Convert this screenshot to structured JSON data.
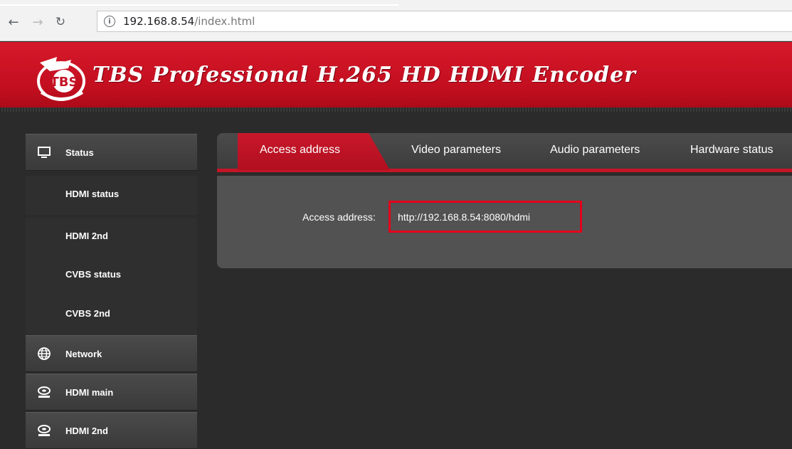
{
  "browser": {
    "back_icon": "back-arrow-icon",
    "forward_icon": "forward-arrow-icon",
    "reload_icon": "reload-icon",
    "url_host": "192.168.8.54",
    "url_path": "/index.html"
  },
  "banner": {
    "title": "TBS Professional H.265 HD HDMI Encoder",
    "logo_text": "TBS"
  },
  "sidebar": {
    "sections": [
      {
        "label": "Status",
        "icon": "monitor-icon"
      },
      {
        "label": "Network",
        "icon": "globe-icon"
      },
      {
        "label": "HDMI main",
        "icon": "hdd-icon"
      },
      {
        "label": "HDMI 2nd",
        "icon": "hdd-icon"
      }
    ],
    "status_items": [
      "HDMI status",
      "HDMI 2nd",
      "CVBS status",
      "CVBS 2nd"
    ]
  },
  "tabs": [
    {
      "label": "Access address",
      "active": true
    },
    {
      "label": "Video parameters",
      "active": false
    },
    {
      "label": "Audio parameters",
      "active": false
    },
    {
      "label": "Hardware status",
      "active": false
    }
  ],
  "content": {
    "access_label": "Access address:",
    "access_value": "http://192.168.8.54:8080/hdmi"
  },
  "colors": {
    "brand_red": "#c8182a",
    "highlight": "#e3001b",
    "panel": "#525252",
    "background": "#2b2b2b"
  }
}
